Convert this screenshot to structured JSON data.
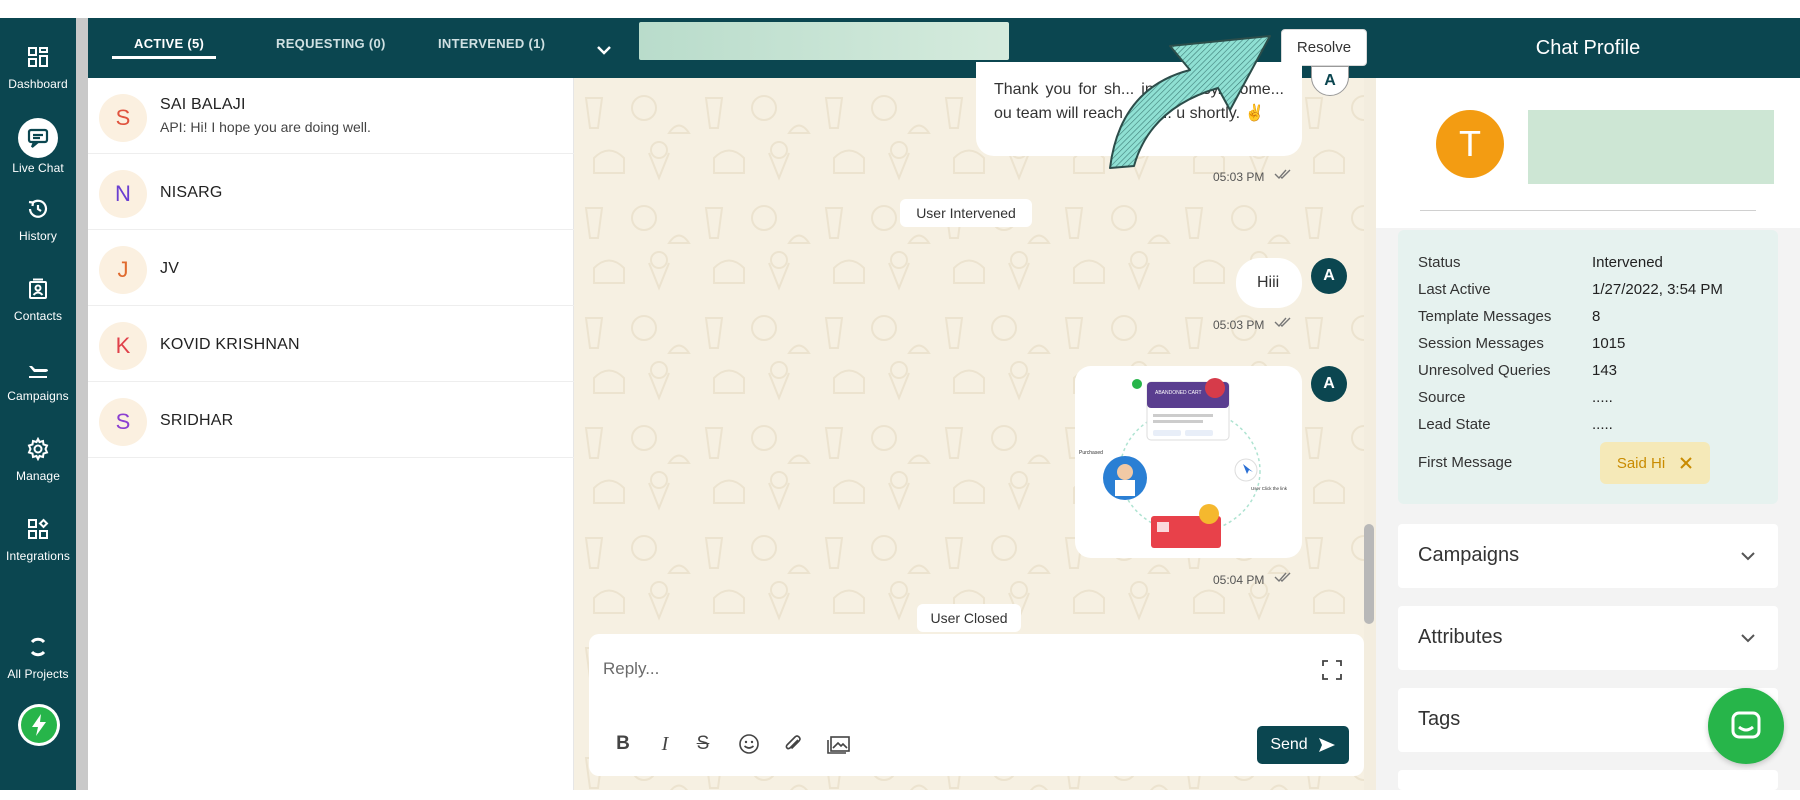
{
  "nav": {
    "items": [
      {
        "label": "Dashboard",
        "icon": "grid-icon"
      },
      {
        "label": "Live Chat",
        "icon": "chat-icon"
      },
      {
        "label": "History",
        "icon": "history-icon"
      },
      {
        "label": "Contacts",
        "icon": "contacts-icon"
      },
      {
        "label": "Campaigns",
        "icon": "plane-icon"
      },
      {
        "label": "Manage",
        "icon": "gear-icon"
      },
      {
        "label": "Integrations",
        "icon": "integrations-icon"
      },
      {
        "label": "All Projects",
        "icon": "projects-icon"
      }
    ]
  },
  "tabs": {
    "active": "ACTIVE (5)",
    "requesting": "REQUESTING (0)",
    "intervened": "INTERVENED (1)"
  },
  "toolbar": {
    "resolve_label": "Resolve"
  },
  "contacts": [
    {
      "initial": "S",
      "name": "SAI BALAJI",
      "preview": "API: Hi! I hope you are doing well.",
      "color": "#e0543f"
    },
    {
      "initial": "N",
      "name": "NISARG",
      "preview": "",
      "color": "#6a3fd1"
    },
    {
      "initial": "J",
      "name": "JV",
      "preview": "",
      "color": "#e06b2f"
    },
    {
      "initial": "K",
      "name": "KOVID KRISHNAN",
      "preview": "",
      "color": "#e0414a"
    },
    {
      "initial": "S",
      "name": "SRIDHAR",
      "preview": "",
      "color": "#8b3fd1"
    }
  ],
  "chat": {
    "msg1_text": "Thank you for sh... in AiSensy. Some... ou team will reach out t... u shortly. ✌",
    "msg1_time": "05:03 PM",
    "sys1": "User Intervened",
    "msg2_text": "Hiii",
    "msg2_time": "05:03 PM",
    "msg3_time": "05:04 PM",
    "sys2": "User Closed",
    "agent_initial": "A",
    "top_avatar_initial": "A"
  },
  "reply": {
    "placeholder": "Reply...",
    "send_label": "Send"
  },
  "profile": {
    "title": "Chat Profile",
    "initial": "T",
    "info": [
      {
        "key": "Status",
        "value": "Intervened"
      },
      {
        "key": "Last Active",
        "value": "1/27/2022, 3:54 PM"
      },
      {
        "key": "Template Messages",
        "value": "8"
      },
      {
        "key": "Session Messages",
        "value": "1015"
      },
      {
        "key": "Unresolved Queries",
        "value": "143"
      },
      {
        "key": "Source",
        "value": "....."
      },
      {
        "key": "Lead State",
        "value": "....."
      },
      {
        "key": "First Message",
        "value": ""
      }
    ],
    "first_message_chip": "Said Hi",
    "sections": [
      "Campaigns",
      "Attributes",
      "Tags"
    ]
  },
  "image_card": {
    "labels": [
      "ABANDONED CART",
      "Purchased",
      "User Click the link"
    ]
  },
  "colors": {
    "brand": "#0b4650",
    "chat_bg": "#f6f0e2",
    "accent_green": "#27b54a",
    "avatar_orange": "#f39c12"
  }
}
